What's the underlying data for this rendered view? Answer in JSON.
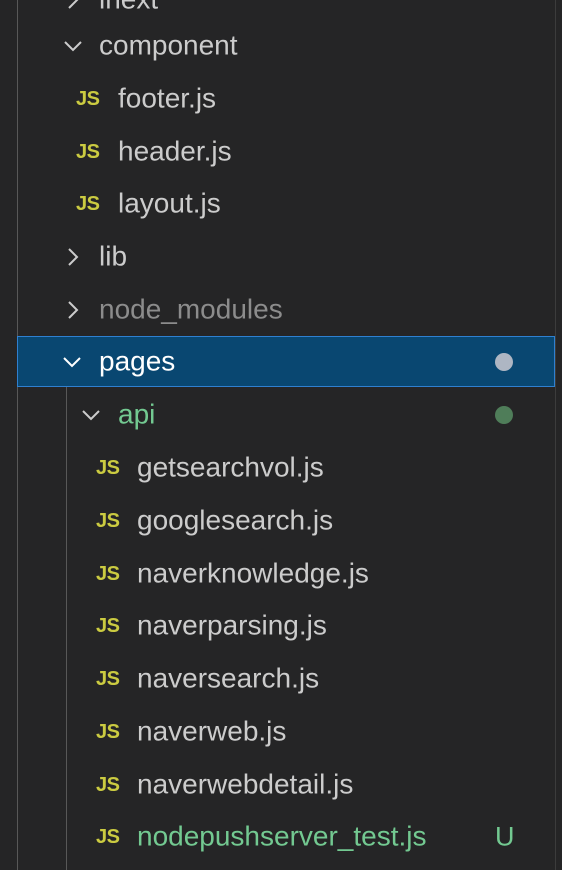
{
  "tree": {
    "partial_top_label": "lnext",
    "items": [
      {
        "label": "component",
        "type": "folder",
        "expanded": true
      },
      {
        "label": "footer.js",
        "type": "file",
        "icon": "JS"
      },
      {
        "label": "header.js",
        "type": "file",
        "icon": "JS"
      },
      {
        "label": "layout.js",
        "type": "file",
        "icon": "JS"
      },
      {
        "label": "lib",
        "type": "folder",
        "expanded": false
      },
      {
        "label": "node_modules",
        "type": "folder",
        "expanded": false,
        "ignored": true
      },
      {
        "label": "pages",
        "type": "folder",
        "expanded": true,
        "selected": true
      },
      {
        "label": "api",
        "type": "folder",
        "expanded": true,
        "git_status": "untracked-contents"
      },
      {
        "label": "getsearchvol.js",
        "type": "file",
        "icon": "JS"
      },
      {
        "label": "googlesearch.js",
        "type": "file",
        "icon": "JS"
      },
      {
        "label": "naverknowledge.js",
        "type": "file",
        "icon": "JS"
      },
      {
        "label": "naverparsing.js",
        "type": "file",
        "icon": "JS"
      },
      {
        "label": "naversearch.js",
        "type": "file",
        "icon": "JS"
      },
      {
        "label": "naverweb.js",
        "type": "file",
        "icon": "JS"
      },
      {
        "label": "naverwebdetail.js",
        "type": "file",
        "icon": "JS"
      },
      {
        "label": "nodepushserver_test.js",
        "type": "file",
        "icon": "JS",
        "badge": "U",
        "git_status": "untracked"
      }
    ]
  },
  "colors": {
    "background": "#252526",
    "text": "#cccccc",
    "dim_text": "#8c8c8c",
    "untracked": "#73c991",
    "js_icon": "#cbcb41",
    "selection_bg": "#094771",
    "selection_border": "#2f80d0",
    "modified_dot": "#aeb6c3",
    "untracked_dot": "#4f7d59"
  },
  "icons": {
    "folder_expanded": "chevron-down-icon",
    "folder_collapsed": "chevron-right-icon",
    "js_file": "js-file-icon",
    "status_dot": "status-dot-icon"
  }
}
